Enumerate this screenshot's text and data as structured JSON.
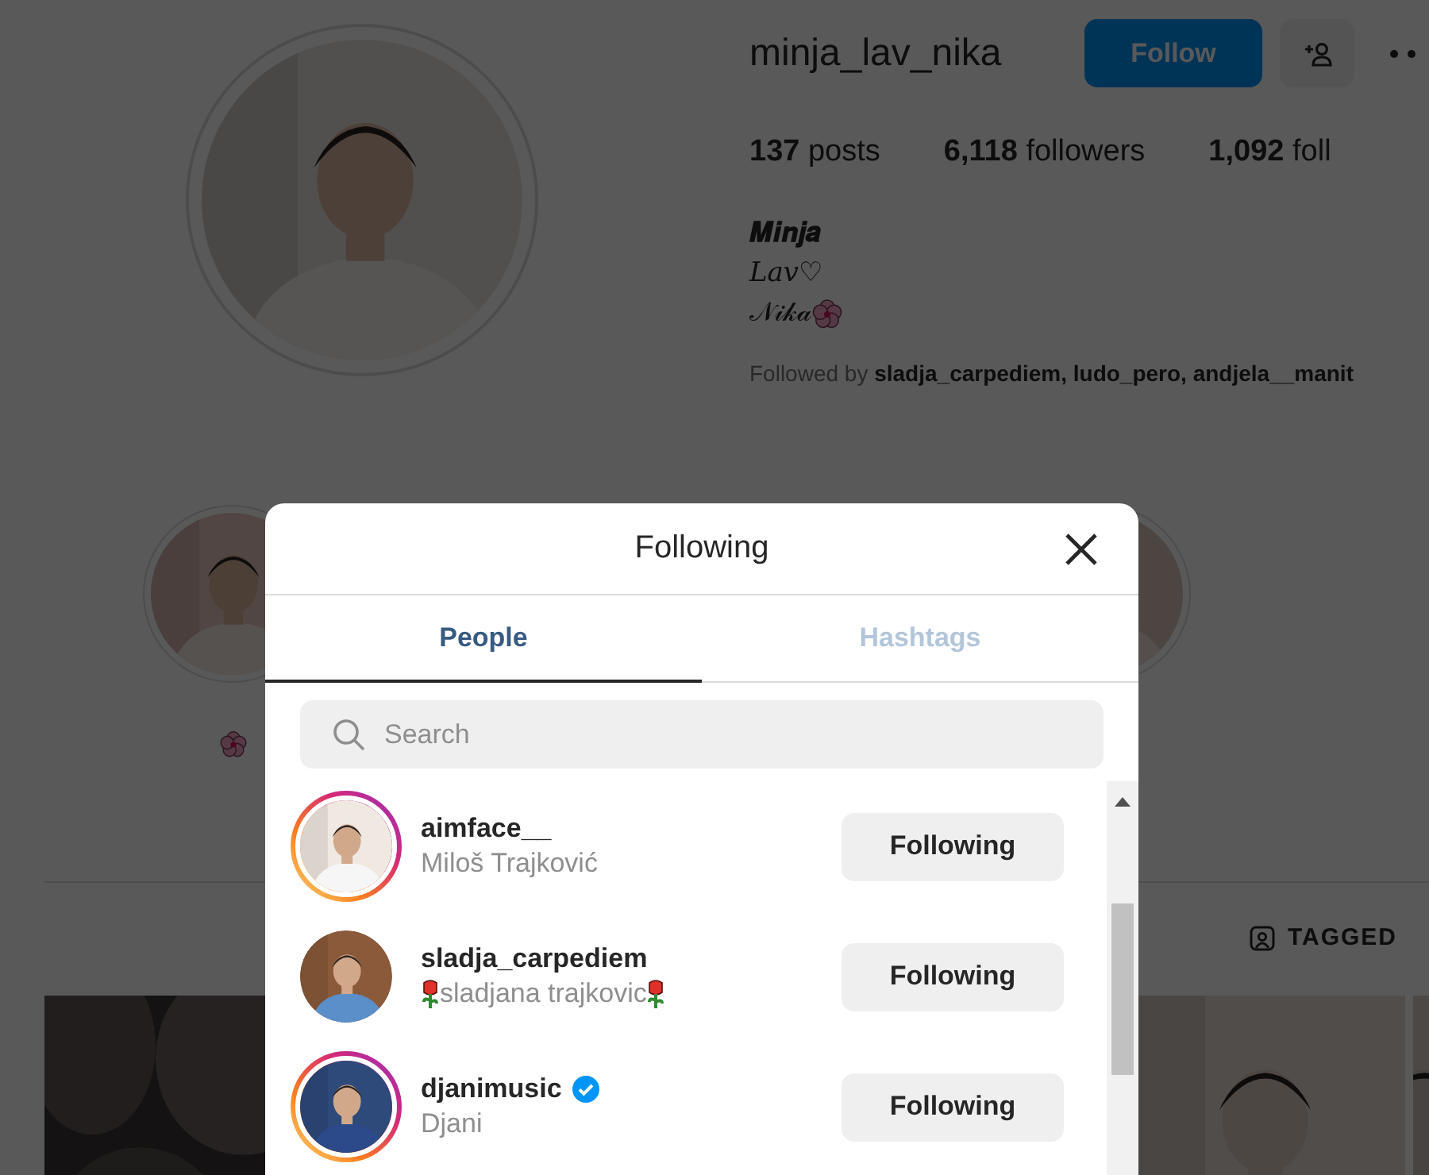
{
  "profile": {
    "username": "minja_lav_nika",
    "follow_button": "Follow",
    "stats": [
      {
        "count": "137",
        "label": "posts"
      },
      {
        "count": "6,118",
        "label": "followers"
      },
      {
        "count": "1,092",
        "label": "foll"
      }
    ],
    "bio": [
      {
        "text": "𝑴𝒊𝒏𝒋𝒂",
        "kind": "plain"
      },
      {
        "text": "𝐿𝑎𝑣♡",
        "kind": "plain"
      },
      {
        "text": "𝒩𝒾𝓀𝒶",
        "kind": "flower"
      }
    ],
    "followed_by": {
      "prefix": "Followed by",
      "names": "sladja_carpediem, ludo_pero, andjela__manit"
    }
  },
  "profile_tabs": [
    {
      "label": "TAGGED"
    }
  ],
  "modal": {
    "title": "Following",
    "tabs": [
      {
        "label": "People",
        "selected": true
      },
      {
        "label": "Hashtags",
        "selected": false
      }
    ],
    "search": {
      "placeholder": "Search"
    },
    "people": [
      {
        "username": "aimface__",
        "full_name": "Miloš Trajković",
        "verified": false,
        "story_ring": true,
        "roses": false,
        "button": "Following"
      },
      {
        "username": "sladja_carpediem",
        "full_name": "sladjana trajkovic",
        "verified": false,
        "story_ring": false,
        "roses": true,
        "button": "Following"
      },
      {
        "username": "djanimusic",
        "full_name": "Djani",
        "verified": true,
        "story_ring": true,
        "roses": false,
        "button": "Following"
      }
    ]
  }
}
